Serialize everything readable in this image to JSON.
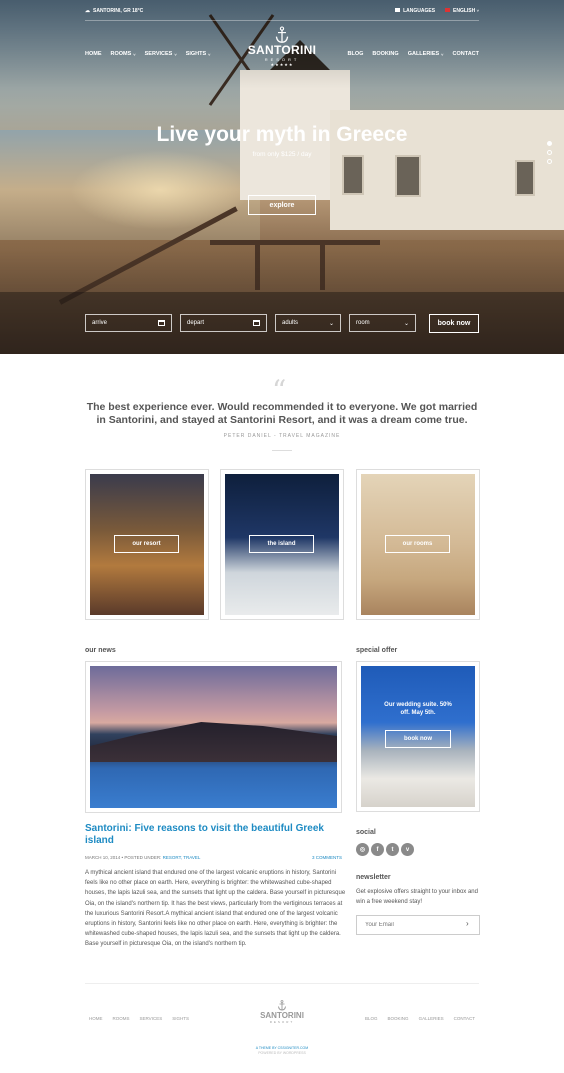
{
  "topbar": {
    "location": "SANTORINI, GR 18°C",
    "languages": "LANGUAGES",
    "language": "ENGLISH"
  },
  "nav": {
    "left": [
      "HOME",
      "ROOMS",
      "SERVICES",
      "SIGHTS"
    ],
    "right": [
      "BLOG",
      "BOOKING",
      "GALLERIES",
      "CONTACT"
    ]
  },
  "logo": {
    "name": "SANTORINI",
    "sub": "RESORT"
  },
  "hero": {
    "title": "Live your myth in Greece",
    "subtitle": "from only $125 / day",
    "button": "explore"
  },
  "booking": {
    "arrive": "arrive",
    "depart": "depart",
    "adults": "adults",
    "room": "room",
    "button": "book now"
  },
  "testimonial": {
    "quote": "The best experience ever. Would recommended it to everyone. We got married in Santorini, and stayed at Santorini Resort, and it was a dream come true.",
    "author": "PETER DANIEL - TRAVEL MAGAZINE"
  },
  "features": [
    "our resort",
    "the island",
    "our rooms"
  ],
  "news": {
    "heading": "our news",
    "title": "Santorini: Five reasons to visit the beautiful Greek island",
    "date": "MARCH 10, 2014",
    "posted_under": "POSTED UNDER:",
    "tags": "RESORT, TRAVEL",
    "comments": "3 COMMENTS",
    "body": "A mythical ancient island that endured one of the largest volcanic eruptions in history, Santorini feels like no other place on earth. Here, everything is brighter: the whitewashed cube-shaped houses, the lapis lazuli sea, and the sunsets that light up the caldera. Base yourself in picturesque Oia, on the island's northern tip. It has the best views, particularly from the vertiginous terraces at the luxurious Santorini Resort.A mythical ancient island that endured one of the largest volcanic eruptions in history, Santorini feels like no other place on earth. Here, everything is brighter: the whitewashed cube-shaped houses, the lapis lazuli sea, and the sunsets that light up the caldera. Base yourself in picturesque Oia, on the island's northern tip."
  },
  "special_offer": {
    "heading": "special offer",
    "text": "Our wedding suite. 50% off. May 5th.",
    "button": "book now"
  },
  "social": {
    "heading": "social",
    "icons": [
      "dribbble-icon",
      "facebook-icon",
      "twitter-icon",
      "vimeo-icon"
    ],
    "glyphs": [
      "◎",
      "f",
      "t",
      "v"
    ]
  },
  "newsletter": {
    "heading": "newsletter",
    "text": "Get explosive offers straight to your inbox and win a free weekend stay!",
    "placeholder": "Your Email"
  },
  "footer": {
    "left": [
      "HOME",
      "ROOMS",
      "SERVICES",
      "SIGHTS"
    ],
    "right": [
      "BLOG",
      "BOOKING",
      "GALLERIES",
      "CONTACT"
    ],
    "logo_name": "SANTORINI",
    "logo_sub": "RESORT",
    "credit": "A THEME BY CSSIGNITER.COM",
    "note": "POWERED BY WORDPRESS"
  },
  "colors": {
    "accent": "#1e8bc3",
    "text": "#555555"
  }
}
